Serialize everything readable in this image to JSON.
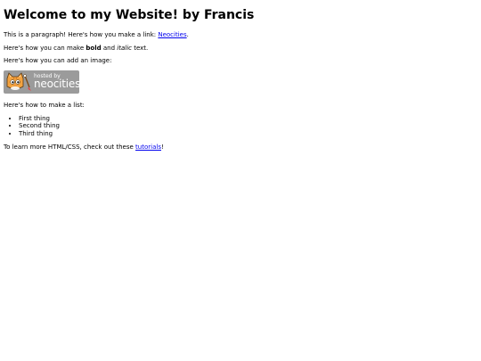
{
  "heading": "Welcome to my Website! by Francis",
  "paragraph_link": {
    "prefix": "This is a paragraph! Here's how you make a link: ",
    "link_text": "Neocities",
    "suffix": "."
  },
  "paragraph_format": {
    "prefix": "Here's how you can make ",
    "bold": "bold",
    "middle": " and ",
    "italic": "italic",
    "suffix": " text."
  },
  "image_intro": "Here's how you can add an image:",
  "badge": {
    "small_text": "hosted by",
    "big_text": "neocities",
    "icon": "neocities-cat-icon",
    "background": "#9b9b9b"
  },
  "list_intro": "Here's how to make a list:",
  "list_items": [
    "First thing",
    "Second thing",
    "Third thing"
  ],
  "footer": {
    "prefix": "To learn more HTML/CSS, check out these ",
    "link_text": "tutorials",
    "suffix": "!"
  },
  "colors": {
    "link": "#0000ee",
    "text": "#000000",
    "background": "#ffffff"
  }
}
